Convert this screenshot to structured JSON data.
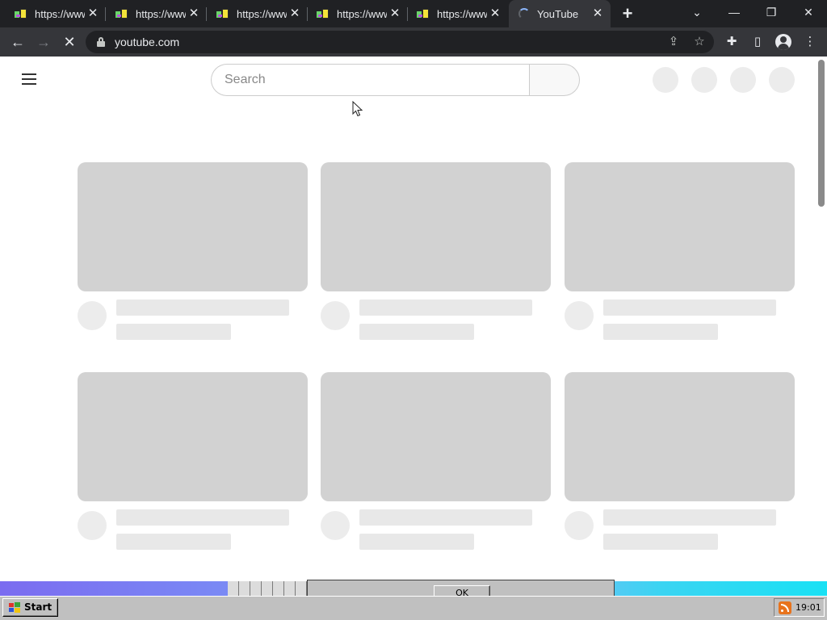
{
  "browser": {
    "tabs": [
      {
        "title": "https://www.",
        "icon": "website-favicon-icon",
        "active": false
      },
      {
        "title": "https://www.",
        "icon": "website-favicon-icon",
        "active": false
      },
      {
        "title": "https://www.",
        "icon": "website-favicon-icon",
        "active": false
      },
      {
        "title": "https://www.",
        "icon": "website-favicon-icon",
        "active": false
      },
      {
        "title": "https://www.",
        "icon": "website-favicon-icon",
        "active": false
      },
      {
        "title": "YouTube",
        "icon": "loading-spinner-icon",
        "active": true
      }
    ],
    "new_tab_glyph": "+",
    "close_glyph": "✕",
    "window_controls": {
      "tab_search": "⌄",
      "minimize": "—",
      "restore": "❐",
      "close": "✕"
    },
    "address": "youtube.com",
    "nav_glyphs": {
      "back": "←",
      "forward": "→",
      "stop": "✕"
    },
    "toolbar_glyphs": {
      "share": "⇪",
      "bookmark": "☆",
      "extensions": "✚",
      "side_panel": "▯",
      "menu": "⋮"
    }
  },
  "youtube": {
    "search": {
      "placeholder": "Search",
      "value": ""
    },
    "header_placeholders": 4,
    "video_placeholders": 6
  },
  "desktop": {
    "dialog_ok_label": "OK",
    "start_label": "Start",
    "clock": "19:01"
  },
  "colors": {
    "chrome_dark": "#202124",
    "chrome_toolbar": "#35363a",
    "skeleton_thumb": "#d2d2d2",
    "skeleton_line": "#e8e8e8",
    "win98_gray": "#c0c0c0"
  }
}
